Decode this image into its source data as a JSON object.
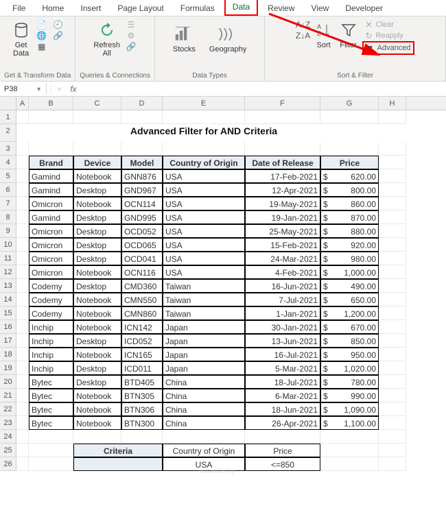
{
  "tabs": {
    "file": "File",
    "home": "Home",
    "insert": "Insert",
    "page": "Page Layout",
    "formulas": "Formulas",
    "data": "Data",
    "review": "Review",
    "view": "View",
    "developer": "Developer"
  },
  "ribbon": {
    "get_data": "Get\nData",
    "refresh": "Refresh\nAll",
    "stocks": "Stocks",
    "geography": "Geography",
    "sort_az": "A→Z",
    "sort_za": "Z→A",
    "sort": "Sort",
    "filter": "Filter",
    "clear": "Clear",
    "reapply": "Reapply",
    "advanced": "Advanced",
    "grp_get": "Get & Transform Data",
    "grp_queries": "Queries & Connections",
    "grp_types": "Data Types",
    "grp_sort": "Sort & Filter"
  },
  "name_box": "P38",
  "fx": "fx",
  "cols": [
    "A",
    "B",
    "C",
    "D",
    "E",
    "F",
    "G",
    "H"
  ],
  "title": "Advanced Filter for AND Criteria",
  "headers": {
    "brand": "Brand",
    "device": "Device",
    "model": "Model",
    "country": "Country of Origin",
    "date": "Date of Release",
    "price": "Price"
  },
  "rows": [
    {
      "brand": "Gamind",
      "device": "Notebook",
      "model": "GNN876",
      "country": "USA",
      "date": "17-Feb-2021",
      "price": "620.00"
    },
    {
      "brand": "Gamind",
      "device": "Desktop",
      "model": "GND967",
      "country": "USA",
      "date": "12-Apr-2021",
      "price": "800.00"
    },
    {
      "brand": "Omicron",
      "device": "Notebook",
      "model": "OCN114",
      "country": "USA",
      "date": "19-May-2021",
      "price": "860.00"
    },
    {
      "brand": "Gamind",
      "device": "Desktop",
      "model": "GND995",
      "country": "USA",
      "date": "19-Jan-2021",
      "price": "870.00"
    },
    {
      "brand": "Omicron",
      "device": "Desktop",
      "model": "OCD052",
      "country": "USA",
      "date": "25-May-2021",
      "price": "880.00"
    },
    {
      "brand": "Omicron",
      "device": "Desktop",
      "model": "OCD065",
      "country": "USA",
      "date": "15-Feb-2021",
      "price": "920.00"
    },
    {
      "brand": "Omicron",
      "device": "Desktop",
      "model": "OCD041",
      "country": "USA",
      "date": "24-Mar-2021",
      "price": "980.00"
    },
    {
      "brand": "Omicron",
      "device": "Notebook",
      "model": "OCN116",
      "country": "USA",
      "date": "4-Feb-2021",
      "price": "1,000.00"
    },
    {
      "brand": "Codemy",
      "device": "Desktop",
      "model": "CMD360",
      "country": "Taiwan",
      "date": "16-Jun-2021",
      "price": "490.00"
    },
    {
      "brand": "Codemy",
      "device": "Notebook",
      "model": "CMN550",
      "country": "Taiwan",
      "date": "7-Jul-2021",
      "price": "650.00"
    },
    {
      "brand": "Codemy",
      "device": "Notebook",
      "model": "CMN860",
      "country": "Taiwan",
      "date": "1-Jan-2021",
      "price": "1,200.00"
    },
    {
      "brand": "Inchip",
      "device": "Notebook",
      "model": "ICN142",
      "country": "Japan",
      "date": "30-Jan-2021",
      "price": "670.00"
    },
    {
      "brand": "Inchip",
      "device": "Desktop",
      "model": "ICD052",
      "country": "Japan",
      "date": "13-Jun-2021",
      "price": "850.00"
    },
    {
      "brand": "Inchip",
      "device": "Notebook",
      "model": "ICN165",
      "country": "Japan",
      "date": "16-Jul-2021",
      "price": "950.00"
    },
    {
      "brand": "Inchip",
      "device": "Desktop",
      "model": "ICD011",
      "country": "Japan",
      "date": "5-Mar-2021",
      "price": "1,020.00"
    },
    {
      "brand": "Bytec",
      "device": "Desktop",
      "model": "BTD405",
      "country": "China",
      "date": "18-Jul-2021",
      "price": "780.00"
    },
    {
      "brand": "Bytec",
      "device": "Notebook",
      "model": "BTN305",
      "country": "China",
      "date": "6-Mar-2021",
      "price": "990.00"
    },
    {
      "brand": "Bytec",
      "device": "Notebook",
      "model": "BTN306",
      "country": "China",
      "date": "18-Jun-2021",
      "price": "1,090.00"
    },
    {
      "brand": "Bytec",
      "device": "Notebook",
      "model": "BTN300",
      "country": "China",
      "date": "26-Apr-2021",
      "price": "1,100.00"
    }
  ],
  "criteria": {
    "label": "Criteria",
    "country_h": "Country of Origin",
    "price_h": "Price",
    "country_v": "USA",
    "price_v": "<=850"
  },
  "currency": "$",
  "watermark": "exceldemy"
}
